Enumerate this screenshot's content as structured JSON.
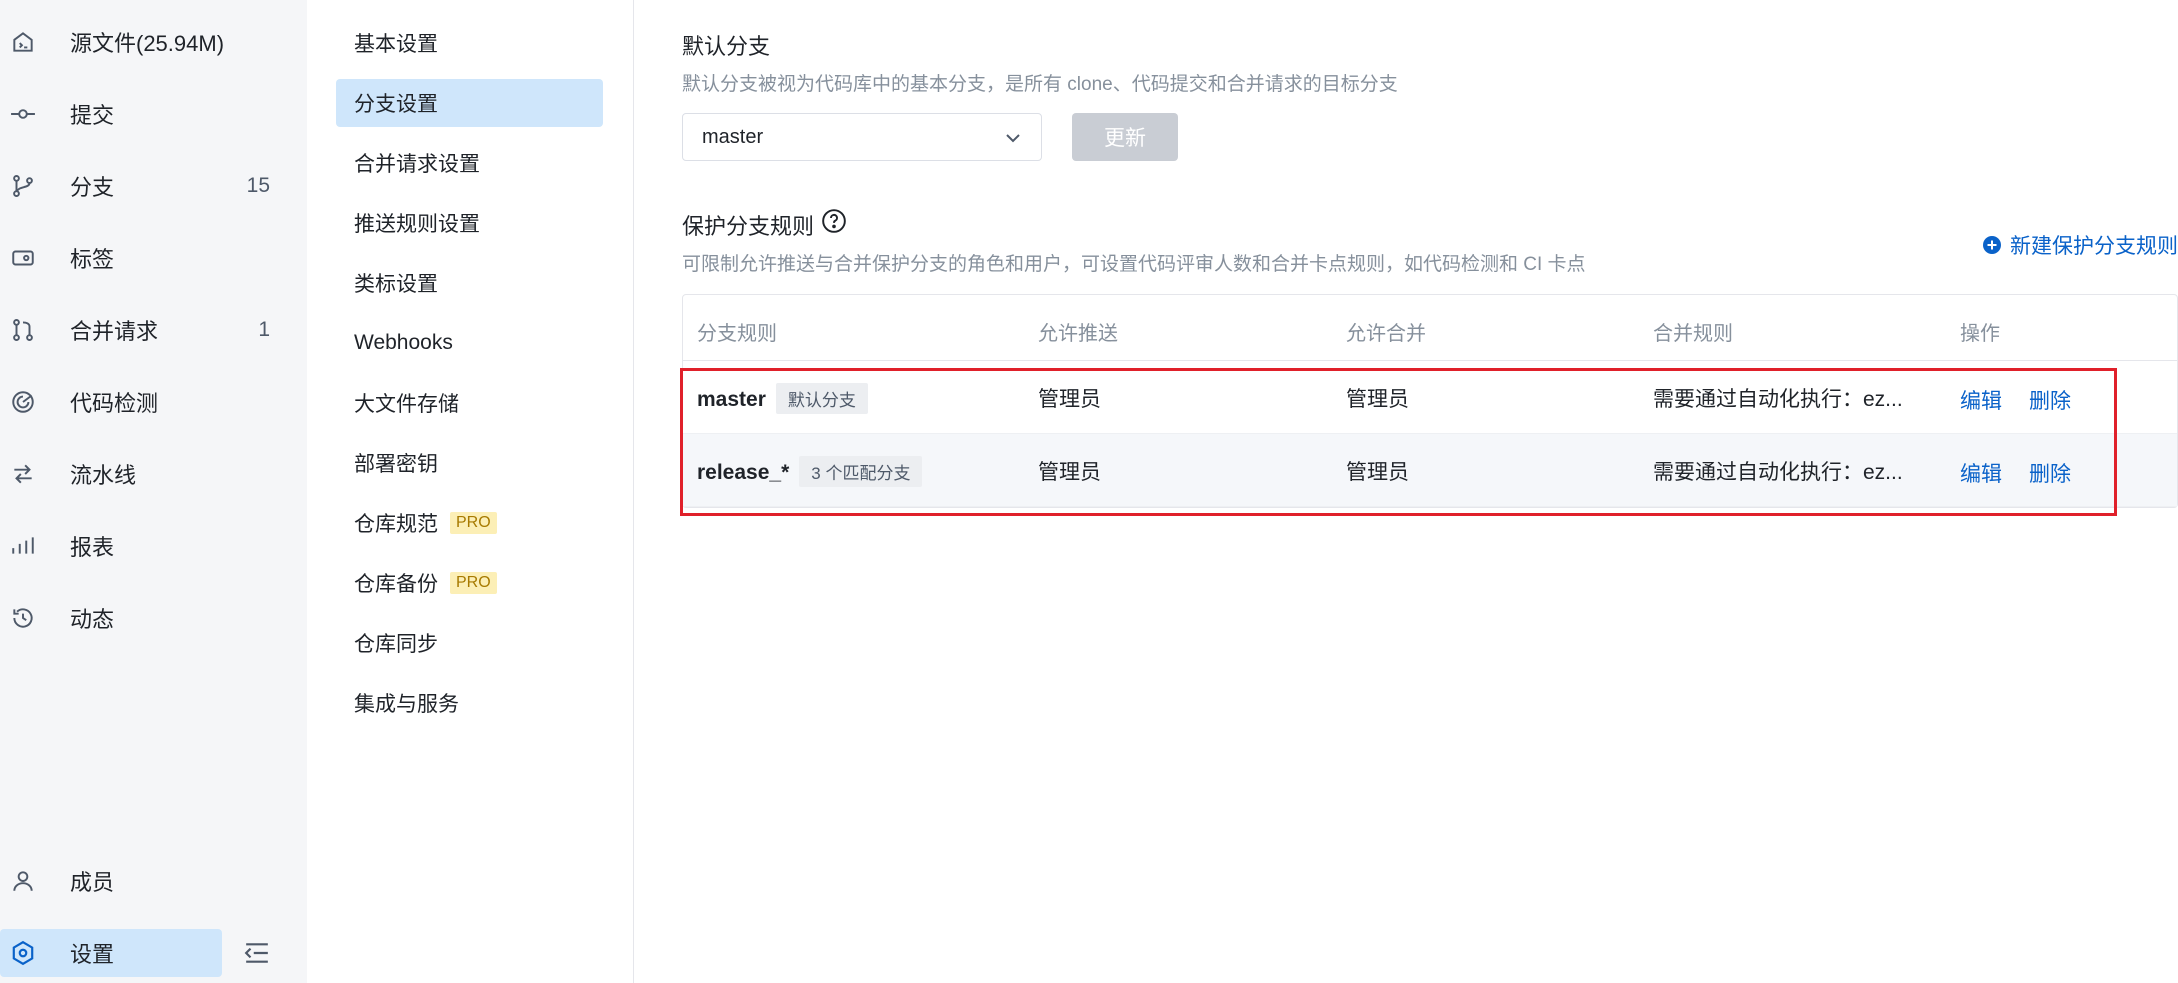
{
  "sidebar": {
    "items": [
      {
        "label": "源文件(25.94M)",
        "count": "",
        "icon": "file-code-icon"
      },
      {
        "label": "提交",
        "count": "",
        "icon": "commit-icon"
      },
      {
        "label": "分支",
        "count": "15",
        "icon": "branch-icon"
      },
      {
        "label": "标签",
        "count": "",
        "icon": "tag-icon"
      },
      {
        "label": "合并请求",
        "count": "1",
        "icon": "merge-request-icon"
      },
      {
        "label": "代码检测",
        "count": "",
        "icon": "code-scan-icon"
      },
      {
        "label": "流水线",
        "count": "",
        "icon": "pipeline-icon"
      },
      {
        "label": "报表",
        "count": "",
        "icon": "chart-bars-icon"
      },
      {
        "label": "动态",
        "count": "",
        "icon": "history-icon"
      }
    ],
    "members": {
      "label": "成员",
      "icon": "user-icon"
    },
    "settings": {
      "label": "设置",
      "icon": "settings-icon",
      "active": true
    },
    "collapse_icon": "collapse-sidebar-icon"
  },
  "settings_menu": {
    "items": [
      {
        "label": "基本设置",
        "pro": ""
      },
      {
        "label": "分支设置",
        "pro": "",
        "active": true
      },
      {
        "label": "合并请求设置",
        "pro": ""
      },
      {
        "label": "推送规则设置",
        "pro": ""
      },
      {
        "label": "类标设置",
        "pro": ""
      },
      {
        "label": "Webhooks",
        "pro": ""
      },
      {
        "label": "大文件存储",
        "pro": ""
      },
      {
        "label": "部署密钥",
        "pro": ""
      },
      {
        "label": "仓库规范",
        "pro": "PRO"
      },
      {
        "label": "仓库备份",
        "pro": "PRO"
      },
      {
        "label": "仓库同步",
        "pro": ""
      },
      {
        "label": "集成与服务",
        "pro": ""
      }
    ]
  },
  "default_branch": {
    "title": "默认分支",
    "description": "默认分支被视为代码库中的基本分支，是所有 clone、代码提交和合并请求的目标分支",
    "selected": "master",
    "update_label": "更新"
  },
  "protected": {
    "title": "保护分支规则",
    "description": "可限制允许推送与合并保护分支的角色和用户，可设置代码评审人数和合并卡点规则，如代码检测和 CI 卡点",
    "new_rule_label": "新建保护分支规则",
    "columns": [
      "分支规则",
      "允许推送",
      "允许合并",
      "合并规则",
      "操作"
    ],
    "rows": [
      {
        "branch": "master",
        "tag": "默认分支",
        "push": "管理员",
        "merge": "管理员",
        "rule": "需要通过自动化执行：ez...",
        "edit": "编辑",
        "delete": "删除"
      },
      {
        "branch": "release_*",
        "tag": "3 个匹配分支",
        "push": "管理员",
        "merge": "管理员",
        "rule": "需要通过自动化执行：ez...",
        "edit": "编辑",
        "delete": "删除"
      }
    ]
  },
  "colors": {
    "accent": "#0a62c9",
    "active_bg": "#cfe6fb",
    "highlight_border": "#e0202a"
  }
}
